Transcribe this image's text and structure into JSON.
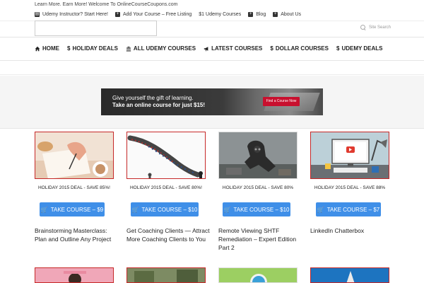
{
  "topbar": {
    "tagline": "Learn More. Earn More! Welcome To OnlineCourseCoupons.com",
    "links": [
      {
        "label": "Udemy Instructor? Start Here!",
        "icon": "document-icon"
      },
      {
        "label": "Add Your Course – Free Listing",
        "icon": "plus-square-icon"
      },
      {
        "label": "$1 Udemy Courses",
        "icon": "none"
      },
      {
        "label": "Blog",
        "icon": "plus-square-icon"
      },
      {
        "label": "About Us",
        "icon": "plus-square-icon"
      }
    ]
  },
  "header": {
    "search_placeholder": "Site Search"
  },
  "nav": {
    "items": [
      {
        "label": "HOME",
        "icon": "home-icon"
      },
      {
        "label": "HOLIDAY DEALS",
        "icon": "dollar-icon"
      },
      {
        "label": "ALL UDEMY COURSES",
        "icon": "institution-icon"
      },
      {
        "label": "LATEST COURSES",
        "icon": "megaphone-icon"
      },
      {
        "label": "DOLLAR COURSES",
        "icon": "dollar-icon"
      },
      {
        "label": "UDEMY DEALS",
        "icon": "dollar-icon"
      }
    ]
  },
  "banner": {
    "line1": "Give yourself the gift of learning.",
    "line2": "Take an online course for just $15!",
    "cta": "Find a Course Now"
  },
  "cards": [
    {
      "deal": "HOLIDAY 2015 DEAL - SAVE 85%!",
      "button": "TAKE COURSE – $9",
      "title": "Brainstorming Masterclass: Plan and Outline Any Project"
    },
    {
      "deal": "HOLIDAY 2015 DEAL - SAVE 80%!",
      "button": "TAKE COURSE – $10",
      "title": "Get Coaching Clients — Attract More Coaching Clients to You"
    },
    {
      "deal": "HOLIDAY 2015 DEAL - SAVE 80%",
      "button": "TAKE COURSE – $10",
      "title": "Remote Viewing SHTF Remediation – Expert Edition Part 2"
    },
    {
      "deal": "HOLIDAY 2015 DEAL - SAVE 88%",
      "button": "TAKE COURSE – $7",
      "title": "LinkedIn Chatterbox"
    }
  ],
  "colors": {
    "accent_button": "#3f8fe8",
    "thumb_border": "#c62828",
    "banner_cta": "#c8102e"
  }
}
